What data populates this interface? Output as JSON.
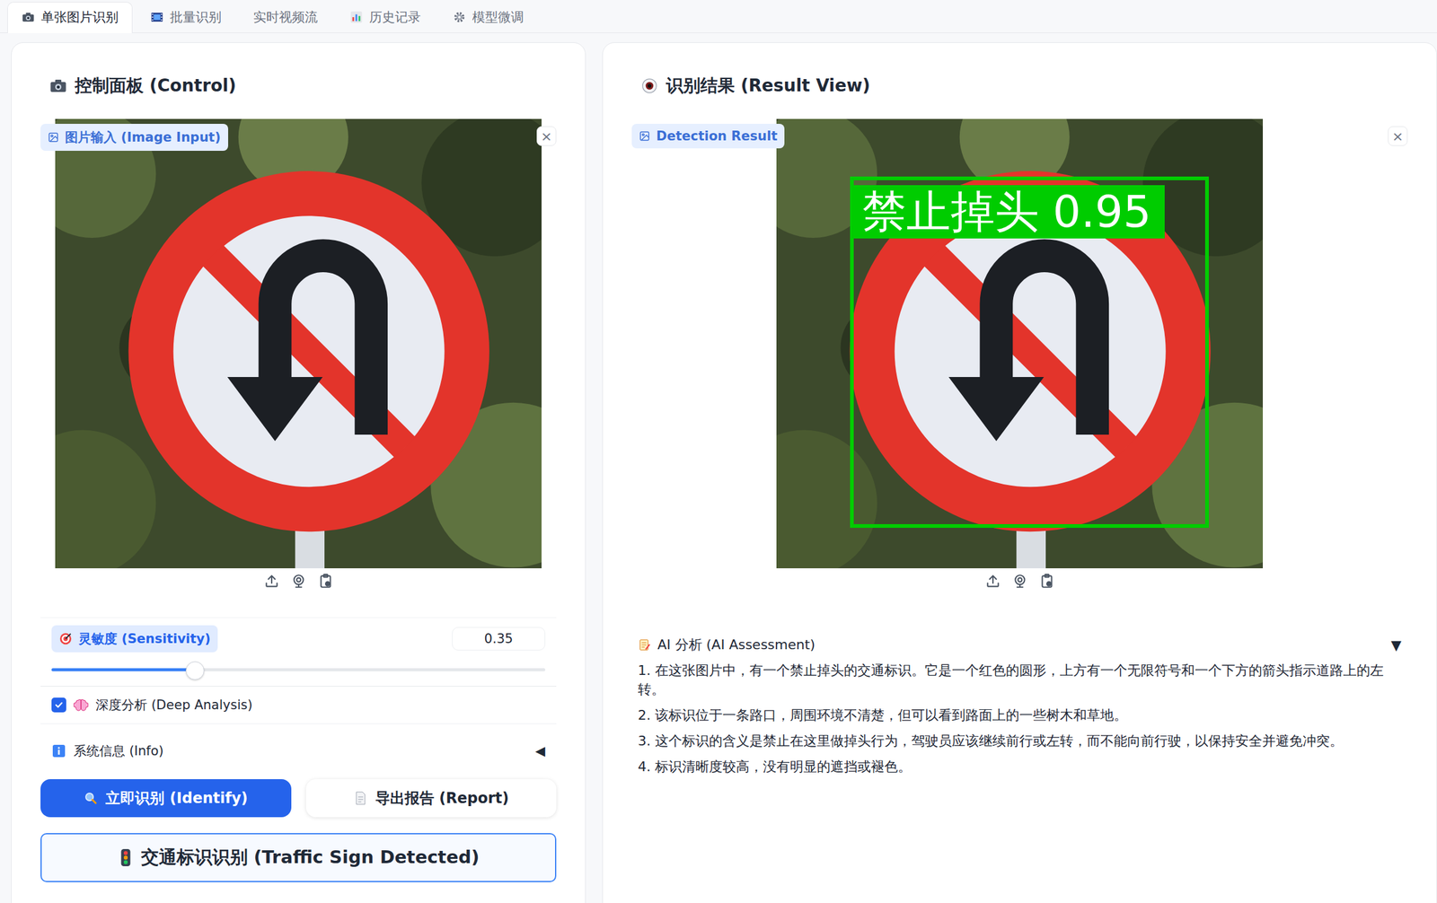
{
  "tabs": [
    {
      "label": "单张图片识别",
      "selected": true
    },
    {
      "label": "批量识别",
      "selected": false
    },
    {
      "label": "实时视频流",
      "selected": false
    },
    {
      "label": "历史记录",
      "selected": false
    },
    {
      "label": "模型微调",
      "selected": false
    }
  ],
  "control": {
    "title": "控制面板 (Control)",
    "image_input": {
      "label": "图片输入 (Image Input)",
      "close": "×"
    },
    "sensitivity": {
      "label": "灵敏度 (Sensitivity)",
      "value": "0.35",
      "level": 0.29
    },
    "deep_analysis": {
      "label": "深度分析 (Deep Analysis)",
      "checked": true
    },
    "info": {
      "label": "系统信息 (Info)",
      "toggle": "◀",
      "expanded": false
    },
    "buttons": [
      {
        "label": "立即识别 (Identify)",
        "kind": "primary"
      },
      {
        "label": "导出报告 (Report)",
        "kind": "secondary"
      }
    ],
    "status": {
      "title": "交通标识识别 (Traffic Sign Detected)"
    }
  },
  "result": {
    "title": "识别结果 (Result View)",
    "image": {
      "label": "Detection Result",
      "close": "×",
      "detection": "禁止掉头 0.95"
    },
    "assessment": {
      "title": "AI 分析 (AI Assessment)",
      "toggle": "▼",
      "expanded": true,
      "items": [
        "1. 在这张图片中，有一个禁止掉头的交通标识。它是一个红色的圆形，上方有一个无限符号和一个下方的箭头指示道路上的左转。",
        "2. 该标识位于一条路口，周围环境不清楚，但可以看到路面上的一些树木和草地。",
        "3. 这个标识的含义是禁止在这里做掉头行为，驾驶员应该继续前行或左转，而不能向前行驶，以保持安全并避免冲突。",
        "4. 标识清晰度较高，没有明显的遮挡或褪色。"
      ]
    }
  }
}
